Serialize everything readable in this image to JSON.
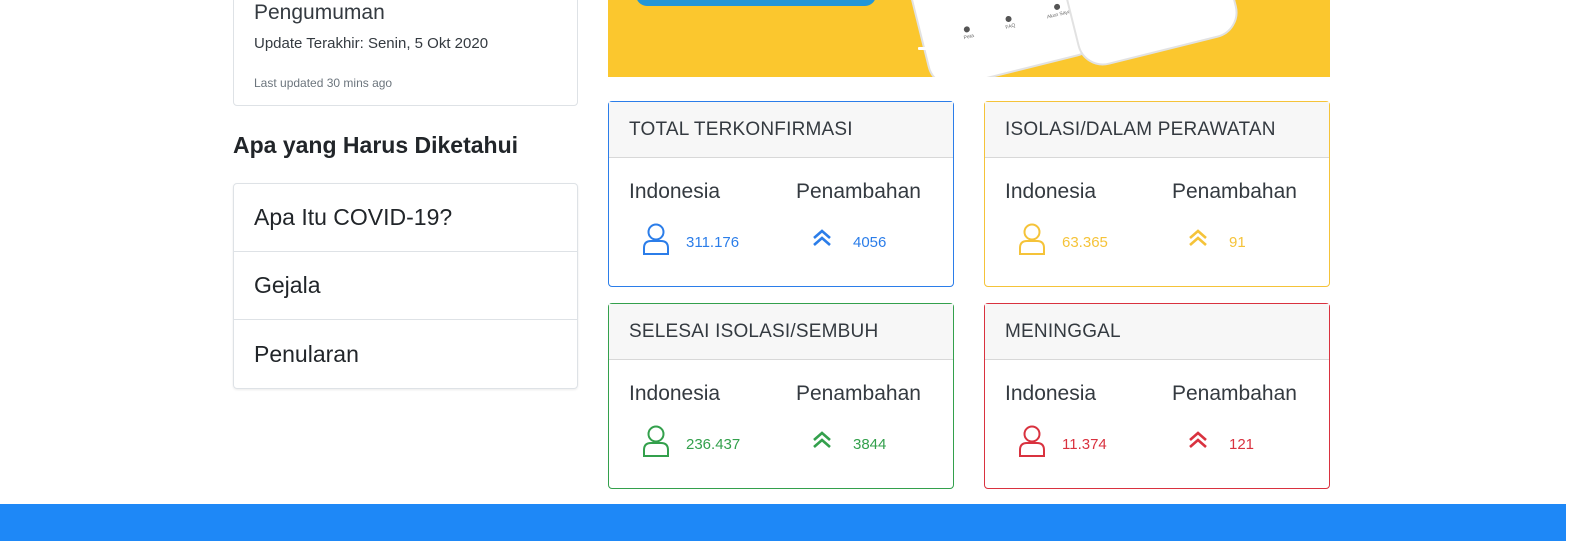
{
  "announcement": {
    "title": "Pengumuman",
    "update": "Update Terakhir: Senin, 5 Okt 2020",
    "last_updated": "Last updated 30 mins ago"
  },
  "know": {
    "heading": "Apa yang Harus Diketahui",
    "items": [
      "Apa Itu COVID-19?",
      "Gejala",
      "Penularan"
    ]
  },
  "banner": {
    "phone_labels": [
      "Peta",
      "FAQ",
      "Akun Saya"
    ]
  },
  "stats": [
    {
      "title": "TOTAL TERKONFIRMASI",
      "left_label": "Indonesia",
      "right_label": "Penambahan",
      "total": "311.176",
      "increase": "4056",
      "color": "#2b7de9"
    },
    {
      "title": "ISOLASI/DALAM PERAWATAN",
      "left_label": "Indonesia",
      "right_label": "Penambahan",
      "total": "63.365",
      "increase": "91",
      "color": "#f5c339"
    },
    {
      "title": "SELESAI ISOLASI/SEMBUH",
      "left_label": "Indonesia",
      "right_label": "Penambahan",
      "total": "236.437",
      "increase": "3844",
      "color": "#33a04c"
    },
    {
      "title": "MENINGGAL",
      "left_label": "Indonesia",
      "right_label": "Penambahan",
      "total": "11.374",
      "increase": "121",
      "color": "#d9323f"
    }
  ],
  "colors": {
    "footer": "#1e88f7",
    "banner_orange": "#f5a623",
    "banner_yellow": "#fbc72e"
  },
  "icons": {
    "person": "user-icon",
    "increase": "double-chevron-up-icon"
  }
}
